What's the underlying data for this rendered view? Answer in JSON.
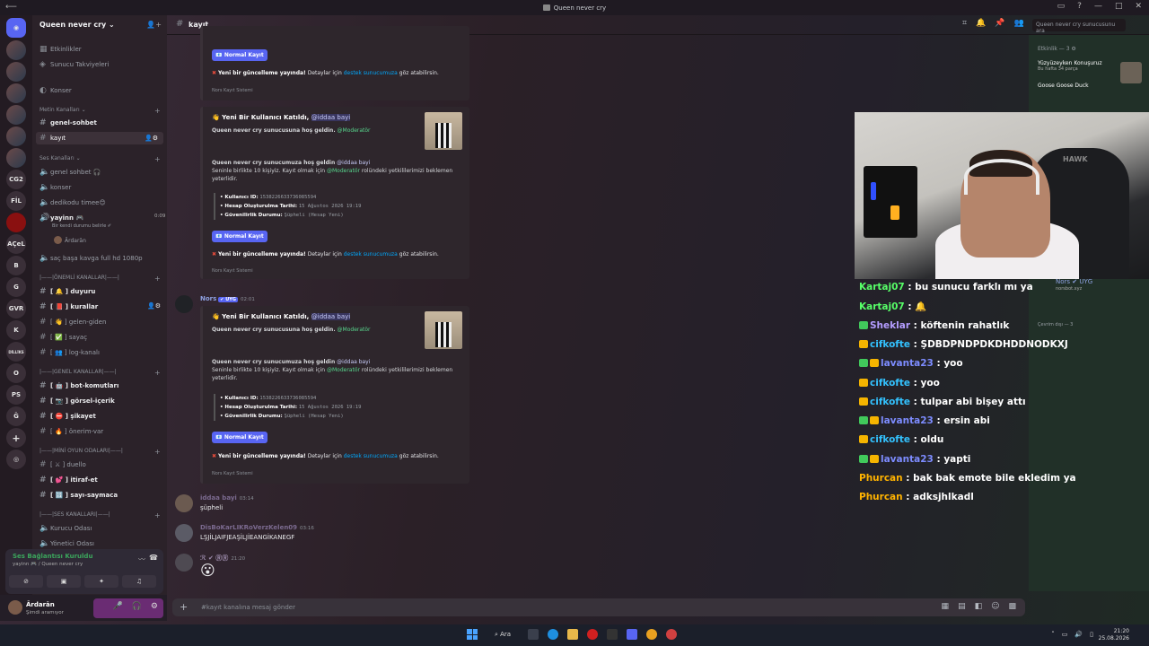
{
  "window": {
    "title": "Queen never cry"
  },
  "server": {
    "name": "Queen never cry ⌄"
  },
  "servers_rail": [
    "CG2",
    "FİL",
    "AÇeL",
    "B",
    "G",
    "GVR",
    "K",
    "DİLLİKS",
    "O",
    "PS",
    "Ğ"
  ],
  "channels": {
    "top": [
      "Etkinlikler",
      "Sunucu Takviyeleri",
      "Konser"
    ],
    "text_category": "Metin Kanalları ⌄",
    "text_channels": [
      "genel-sohbet",
      "kayıt"
    ],
    "voice_category": "Ses Kanalları ⌄",
    "voice_channels": [
      "genel sohbet 🎧",
      "konser",
      "dedikodu timee😊",
      "yayinn 🎮"
    ],
    "yayinn_time": "0:09",
    "yayinn_sub": "Bir kendi durumu belirle ✐",
    "yayinn_user": "Ārdarān",
    "extra_voice": "saç başa kavga full hd 1080p",
    "cat_onemli": "|——|ÖNEMLİ KANALLAR|——|",
    "onemli": [
      "[ 🔔 ] duyuru",
      "[ 📕 ] kurallar",
      "[ 👋 ] gelen-giden",
      "[ ✅ ] sayaç",
      "[ 👥 ] log-kanalı"
    ],
    "cat_genel": "|——|GENEL KANALLAR|——|",
    "genel": [
      "[ 🤖 ] bot-komutları",
      "[ 📷 ] görsel-içerik",
      "[ ⛔ ] şikayet",
      "[ 🔥 ] önerim-var"
    ],
    "cat_oyun": "|——|MİNİ OYUN ODALARI|——|",
    "oyun": [
      "[ ⚔ ] duello",
      "[ 💕 ] itiraf-et",
      "[ 🔢 ] sayı-saymaca"
    ],
    "cat_ses": "|——|SES KANALLARI|——|",
    "ses": [
      "Kurucu Odası",
      "Yönetici Odası"
    ]
  },
  "voice_panel": {
    "status": "Ses Bağlantısı Kuruldu",
    "sub": "yayinn 🎮 / Queen never cry"
  },
  "user": {
    "name": "Ārdarān",
    "status": "Şimdi aramıyor"
  },
  "header": {
    "channel": "kayıt",
    "search_placeholder": "Queen never cry sunucusunu ara"
  },
  "embed": {
    "title_prefix": "👋 Yeni Bir Kullanıcı Katıldı,",
    "mention": "@iddaa bayi",
    "welcome": "Queen never cry sunucusuna hoş geldin.",
    "role": "@Moderatör",
    "line1": "Queen never cry sunucumuza hoş geldin",
    "line2": "Seninle birlikte 10 kişiyiz. Kayıt olmak için",
    "line3": "rolündeki yetkililerimizi beklemen yeterlidir.",
    "user_id_label": "• Kullanıcı ID:",
    "user_id": "1538226633736085594",
    "created_label": "• Hesap Oluşturulma Tarihi:",
    "created": "15 Ağustos 2026 19:19",
    "security_label": "• Güvenilirlik Durumu:",
    "security": "Şüpheli (Hesap Yeni)",
    "button": "📧 Normal Kayıt",
    "notice_bold": "Yeni bir güncelleme yayında!",
    "notice_text": "Detaylar için",
    "notice_link": "destek sunucumuza",
    "notice_end": "göz atabilirsin.",
    "system": "Nors Kayıt Sistemi"
  },
  "bot": {
    "name": "Nors",
    "tag": "✔ UYG",
    "time": "02:01"
  },
  "messages": [
    {
      "name": "iddaa bayi",
      "time": "03:14",
      "text": "şüpheli"
    },
    {
      "name": "DisBoKarLIKRoVerzKelen09",
      "time": "03:16",
      "text": "LŞJİLJAIFJEAŞİLJİEANGİKANEGF"
    },
    {
      "name": "ℛ ✔ ⓇⓇ",
      "time": "21:20",
      "text": "😮"
    }
  ],
  "composer": {
    "placeholder": "#kayıt kanalına mesaj gönder"
  },
  "right_panel": {
    "activity_label": "Etkinlik — 3 ⚙",
    "activity_title": "Yüzyüzeyken Konuşuruz",
    "activity_sub": "Bu hafta 34 parça",
    "activity2": "Goose Goose Duck",
    "nors": "Nors ✔ UYG",
    "nors_sub": "norsbot.xyz",
    "offline": "Çevrim dışı — 3"
  },
  "stream_chat": [
    {
      "user": "Kartaj07",
      "text": ": bu sunucu farklı mı ya",
      "color": "#57ff68",
      "badge": ""
    },
    {
      "user": "Kartaj07",
      "text": ": 🔔",
      "color": "#57ff68",
      "badge": ""
    },
    {
      "user": "Sheklar",
      "text": ": köftenin rahatlık",
      "color": "#b49dff",
      "badge": "g"
    },
    {
      "user": "cifkofte",
      "text": ": ŞDBDPNDPDKDHDDNODKXJ",
      "color": "#33c2ff",
      "badge": "y"
    },
    {
      "user": "lavanta23",
      "text": ": yoo",
      "color": "#7d8cff",
      "badge": "gy"
    },
    {
      "user": "cifkofte",
      "text": ": yoo",
      "color": "#33c2ff",
      "badge": "y"
    },
    {
      "user": "cifkofte",
      "text": ": tulpar abi bişey attı",
      "color": "#33c2ff",
      "badge": "y"
    },
    {
      "user": "lavanta23",
      "text": ": ersin abi",
      "color": "#7d8cff",
      "badge": "gy"
    },
    {
      "user": "cifkofte",
      "text": ": oldu",
      "color": "#33c2ff",
      "badge": "y"
    },
    {
      "user": "lavanta23",
      "text": ": yapti",
      "color": "#7d8cff",
      "badge": "gy"
    },
    {
      "user": "Phurcan",
      "text": ": bak bak emote bile ekledim ya",
      "color": "#ffb300",
      "badge": ""
    },
    {
      "user": "Phurcan",
      "text": ": adksjhlkadl",
      "color": "#ffb300",
      "badge": ""
    }
  ],
  "taskbar": {
    "search": "Ara",
    "time": "21:20",
    "date": "25.08.2026"
  }
}
